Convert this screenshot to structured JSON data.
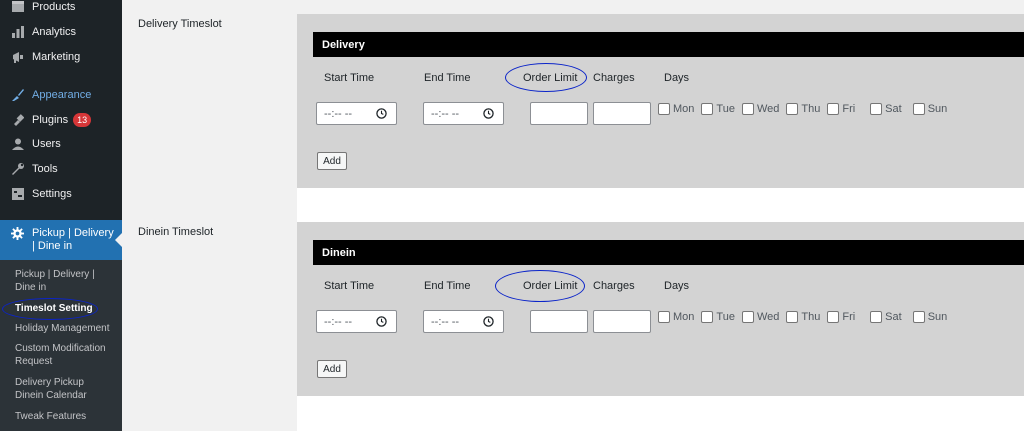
{
  "sidebar": {
    "items": [
      {
        "label": "Products",
        "icon": "products-icon"
      },
      {
        "label": "Analytics",
        "icon": "analytics-icon"
      },
      {
        "label": "Marketing",
        "icon": "marketing-icon"
      },
      {
        "label": "Appearance",
        "icon": "appearance-icon"
      },
      {
        "label": "Plugins",
        "icon": "plugins-icon",
        "badge": "13"
      },
      {
        "label": "Users",
        "icon": "users-icon"
      },
      {
        "label": "Tools",
        "icon": "tools-icon"
      },
      {
        "label": "Settings",
        "icon": "settings-icon"
      }
    ],
    "active": {
      "label": "Pickup | Delivery | Dine in",
      "icon": "gear-icon"
    },
    "submenu": [
      "Pickup | Delivery | Dine in",
      "Timeslot Setting",
      "Holiday Management",
      "Custom Modification Request",
      "Delivery Pickup Dinein Calendar",
      "Tweak Features"
    ],
    "current_submenu_index": 1
  },
  "sections": [
    {
      "label": "Delivery Timeslot",
      "bar_title": "Delivery",
      "headers": {
        "start": "Start Time",
        "end": "End Time",
        "limit": "Order Limit",
        "charges": "Charges",
        "days": "Days"
      },
      "start_value": "--:-- --",
      "end_value": "--:-- --",
      "add_label": "Add"
    },
    {
      "label": "Dinein Timeslot",
      "bar_title": "Dinein",
      "headers": {
        "start": "Start Time",
        "end": "End Time",
        "limit": "Order Limit",
        "charges": "Charges",
        "days": "Days"
      },
      "start_value": "--:-- --",
      "end_value": "--:-- --",
      "add_label": "Add"
    }
  ],
  "days": [
    "Mon",
    "Tue",
    "Wed",
    "Thu",
    "Fri",
    "Sat",
    "Sun"
  ],
  "colors": {
    "sidebar_bg": "#1d2327",
    "active_bg": "#2271b1",
    "annotation": "#0b24c9",
    "panel_bg": "#d3d3d3",
    "badge": "#d63638"
  }
}
